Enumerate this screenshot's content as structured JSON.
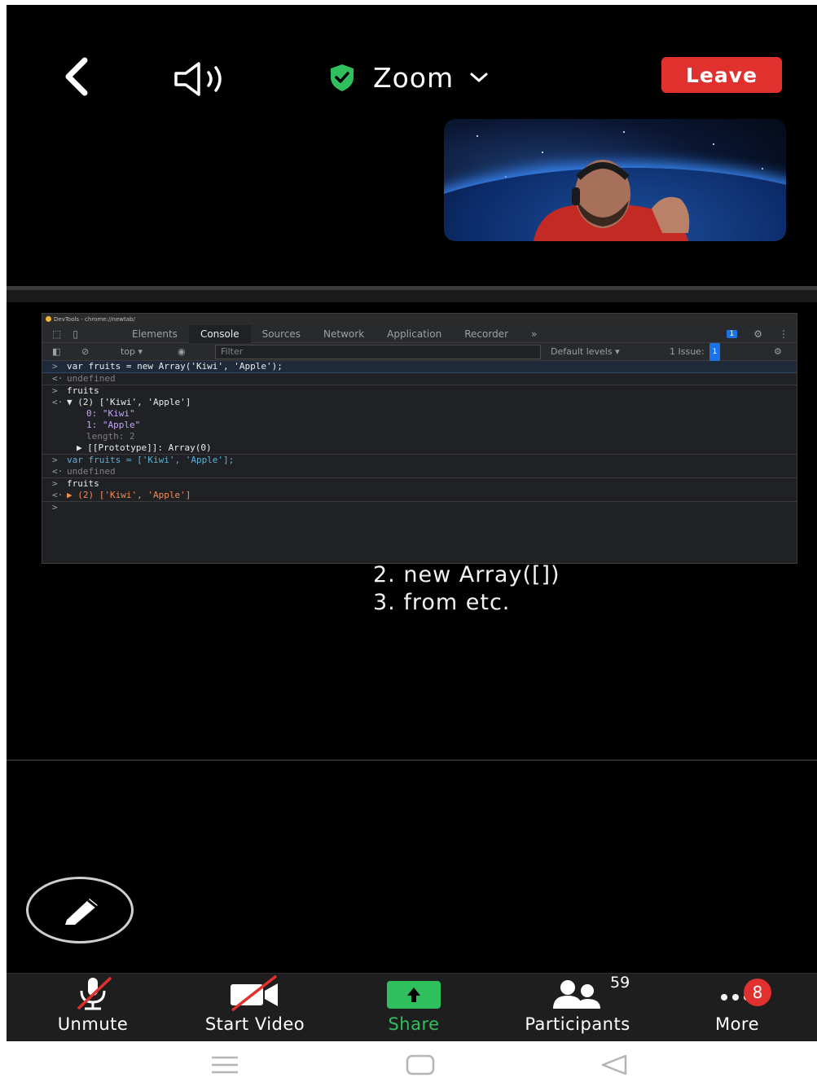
{
  "header": {
    "title": "Zoom",
    "leave_label": "Leave",
    "icons": {
      "back": "chevron-left-icon",
      "speaker": "speaker-icon",
      "shield": "shield-check-icon",
      "dropdown": "chevron-down-icon"
    },
    "colors": {
      "leave": "#e1312f",
      "shield": "#2fbf5d"
    }
  },
  "devtools": {
    "window_title": "DevTools - chrome://newtab/",
    "tabs": [
      "Elements",
      "Console",
      "Sources",
      "Network",
      "Application",
      "Recorder"
    ],
    "active_tab": "Console",
    "more_tabs": "»",
    "issue_count_badge": "1",
    "toolbar": {
      "context": "top",
      "filter_placeholder": "Filter",
      "levels": "Default levels",
      "issues": "1 Issue:",
      "issues_count": "1"
    },
    "console": [
      {
        "prefix": ">",
        "text": "var fruits = new Array('Kiwi', 'Apple');"
      },
      {
        "prefix": "<·",
        "text": "undefined"
      },
      {
        "prefix": ">",
        "text": "fruits"
      },
      {
        "prefix": "<·",
        "text": "▼ (2) ['Kiwi', 'Apple']"
      },
      {
        "prefix": "",
        "text": "0: \"Kiwi\""
      },
      {
        "prefix": "",
        "text": "1: \"Apple\""
      },
      {
        "prefix": "",
        "text": "length: 2"
      },
      {
        "prefix": "",
        "text": "▶ [[Prototype]]: Array(0)"
      },
      {
        "prefix": ">",
        "text": "var fruits = ['Kiwi', 'Apple'];"
      },
      {
        "prefix": "<·",
        "text": "undefined"
      },
      {
        "prefix": ">",
        "text": "fruits"
      },
      {
        "prefix": "<·",
        "text": "▶ (2) ['Kiwi', 'Apple']"
      },
      {
        "prefix": ">",
        "text": ""
      }
    ]
  },
  "slide": {
    "lines": [
      "2. new Array([])",
      "3. from etc."
    ]
  },
  "toolbar": {
    "unmute_label": "Unmute",
    "start_video_label": "Start Video",
    "share_label": "Share",
    "participants_label": "Participants",
    "participants_count": "59",
    "more_label": "More",
    "more_badge": "8",
    "colors": {
      "share": "#2fbf5d",
      "badge": "#e1312f"
    }
  },
  "android_nav": {
    "icons": [
      "menu-icon",
      "home-icon",
      "back-triangle-icon"
    ]
  }
}
